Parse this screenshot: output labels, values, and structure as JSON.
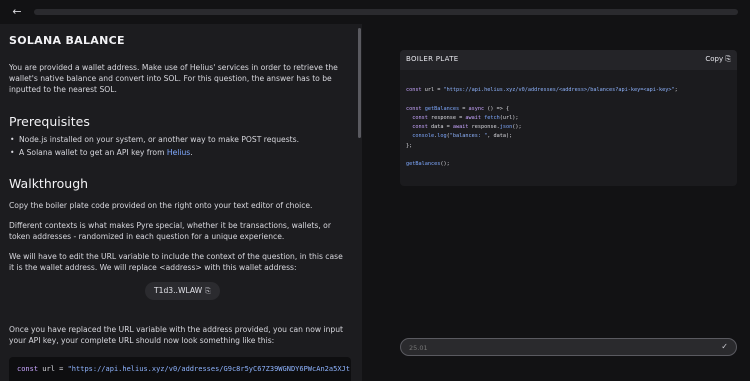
{
  "topbar": {
    "back_icon": "back-arrow-icon",
    "progress": 0.0
  },
  "lesson": {
    "title": "SOLANA BALANCE",
    "intro": "You are provided a wallet address. Make use of Helius' services in order to retrieve the wallet's native balance and convert into SOL. For this question, the answer has to be inputted to the nearest SOL.",
    "prereq_heading": "Prerequisites",
    "prereq_items": [
      "Node.js installed on your system, or another way to make POST requests.",
      "A Solana wallet to get an API key from "
    ],
    "helius_link": "Helius",
    "walkthrough_heading": "Walkthrough",
    "walk_p1": "Copy the boiler plate code provided on the right onto your text editor of choice.",
    "walk_p2": "Different contexts is what makes Pyre special, whether it be transactions, wallets, or token addresses - randomized in each question for a unique experience.",
    "walk_p3": "We will have to edit the URL variable to include the context of the question, in this case it is the wallet address. We will replace <address> with this wallet address:",
    "address_chip": "T1d3..WLAW",
    "walk_p4": "Once you have replaced the URL variable with the address provided, you can now input your API key, your complete URL should now look something like this:",
    "code_snippet_kw": "const",
    "code_snippet_id": " url = ",
    "code_snippet_str": "\"https://api.helius.xyz/v0/addresses/G9c8r5yC67Z39WGNDY6PWcAn2a5XJt"
  },
  "boilerplate": {
    "title": "BOILER PLATE",
    "copy_label": "Copy",
    "lines": [
      {
        "parts": [
          [
            "kw",
            "const"
          ],
          [
            "id",
            " url = "
          ],
          [
            "str",
            "\"https://api.helius.xyz/v0/addresses/<address>/balances?api-key=<api-key>\""
          ],
          [
            "id",
            ";"
          ]
        ]
      },
      {
        "parts": []
      },
      {
        "parts": [
          [
            "kw",
            "const"
          ],
          [
            "id",
            " "
          ],
          [
            "fn",
            "getBalances"
          ],
          [
            "id",
            " = "
          ],
          [
            "kw",
            "async"
          ],
          [
            "id",
            " () => {"
          ]
        ]
      },
      {
        "parts": [
          [
            "id",
            "  "
          ],
          [
            "kw",
            "const"
          ],
          [
            "id",
            " response = "
          ],
          [
            "kw",
            "await"
          ],
          [
            "id",
            " "
          ],
          [
            "fn",
            "fetch"
          ],
          [
            "id",
            "(url);"
          ]
        ]
      },
      {
        "parts": [
          [
            "id",
            "  "
          ],
          [
            "kw",
            "const"
          ],
          [
            "id",
            " data = "
          ],
          [
            "kw",
            "await"
          ],
          [
            "id",
            " response."
          ],
          [
            "fn",
            "json"
          ],
          [
            "id",
            "();"
          ]
        ]
      },
      {
        "parts": [
          [
            "id",
            "  "
          ],
          [
            "fn",
            "console"
          ],
          [
            "id",
            "."
          ],
          [
            "fn",
            "log"
          ],
          [
            "id",
            "("
          ],
          [
            "str",
            "\"balances: \""
          ],
          [
            "id",
            ", data);"
          ]
        ]
      },
      {
        "parts": [
          [
            "id",
            "};"
          ]
        ]
      },
      {
        "parts": []
      },
      {
        "parts": [
          [
            "fn",
            "getBalances"
          ],
          [
            "id",
            "();"
          ]
        ]
      }
    ]
  },
  "answer": {
    "placeholder": "25.01",
    "submit_icon": "check-icon"
  }
}
